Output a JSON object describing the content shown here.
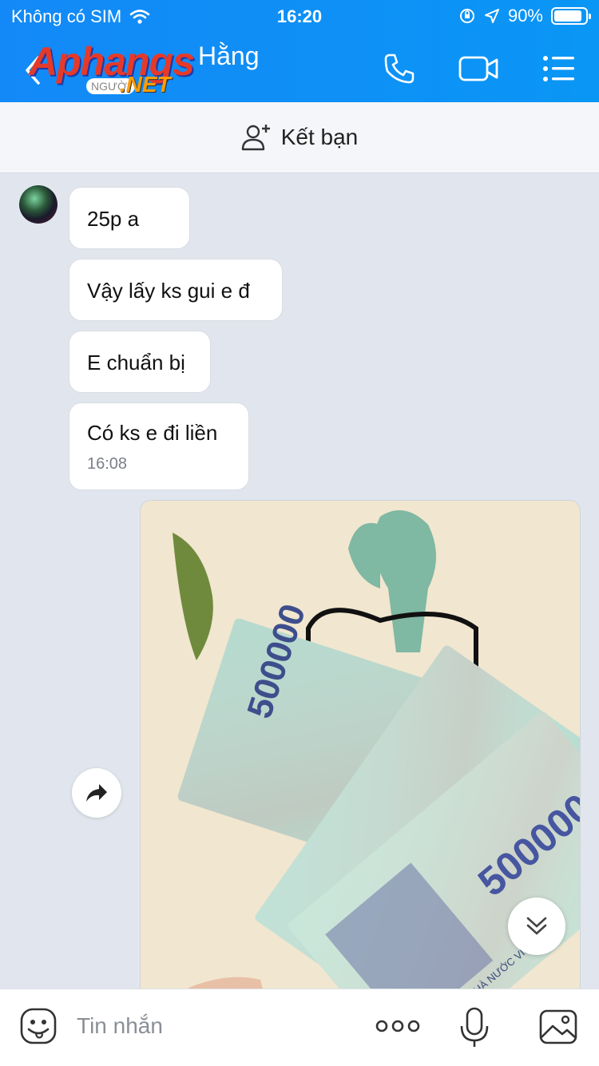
{
  "status_bar": {
    "carrier": "Không có SIM",
    "time": "16:20",
    "battery": "90%",
    "battery_level": 0.9
  },
  "header": {
    "contact_name": "Hằng",
    "watermark": {
      "brand": "Aphangs",
      "suffix": ".NET",
      "tag": "NGƯỜI"
    },
    "icons": [
      "back-icon",
      "phone-icon",
      "video-call-icon",
      "menu-icon"
    ]
  },
  "friend_bar": {
    "label": "Kết bạn"
  },
  "messages": [
    {
      "text": "25p a"
    },
    {
      "text": "Vậy lấy ks gui e đ"
    },
    {
      "text": "E chuẩn bị"
    },
    {
      "text": "Có ks e đi liền",
      "time": "16:08"
    }
  ],
  "photo": {
    "banknote_value": "500000",
    "bank_text": "NGÂN HÀNG NHÀ NƯỚC VIỆT NAM"
  },
  "composer": {
    "placeholder": "Tin nhắn"
  },
  "colors": {
    "header": "#0a92f6",
    "chat_bg": "#e1e6ee",
    "bubble": "#ffffff"
  }
}
